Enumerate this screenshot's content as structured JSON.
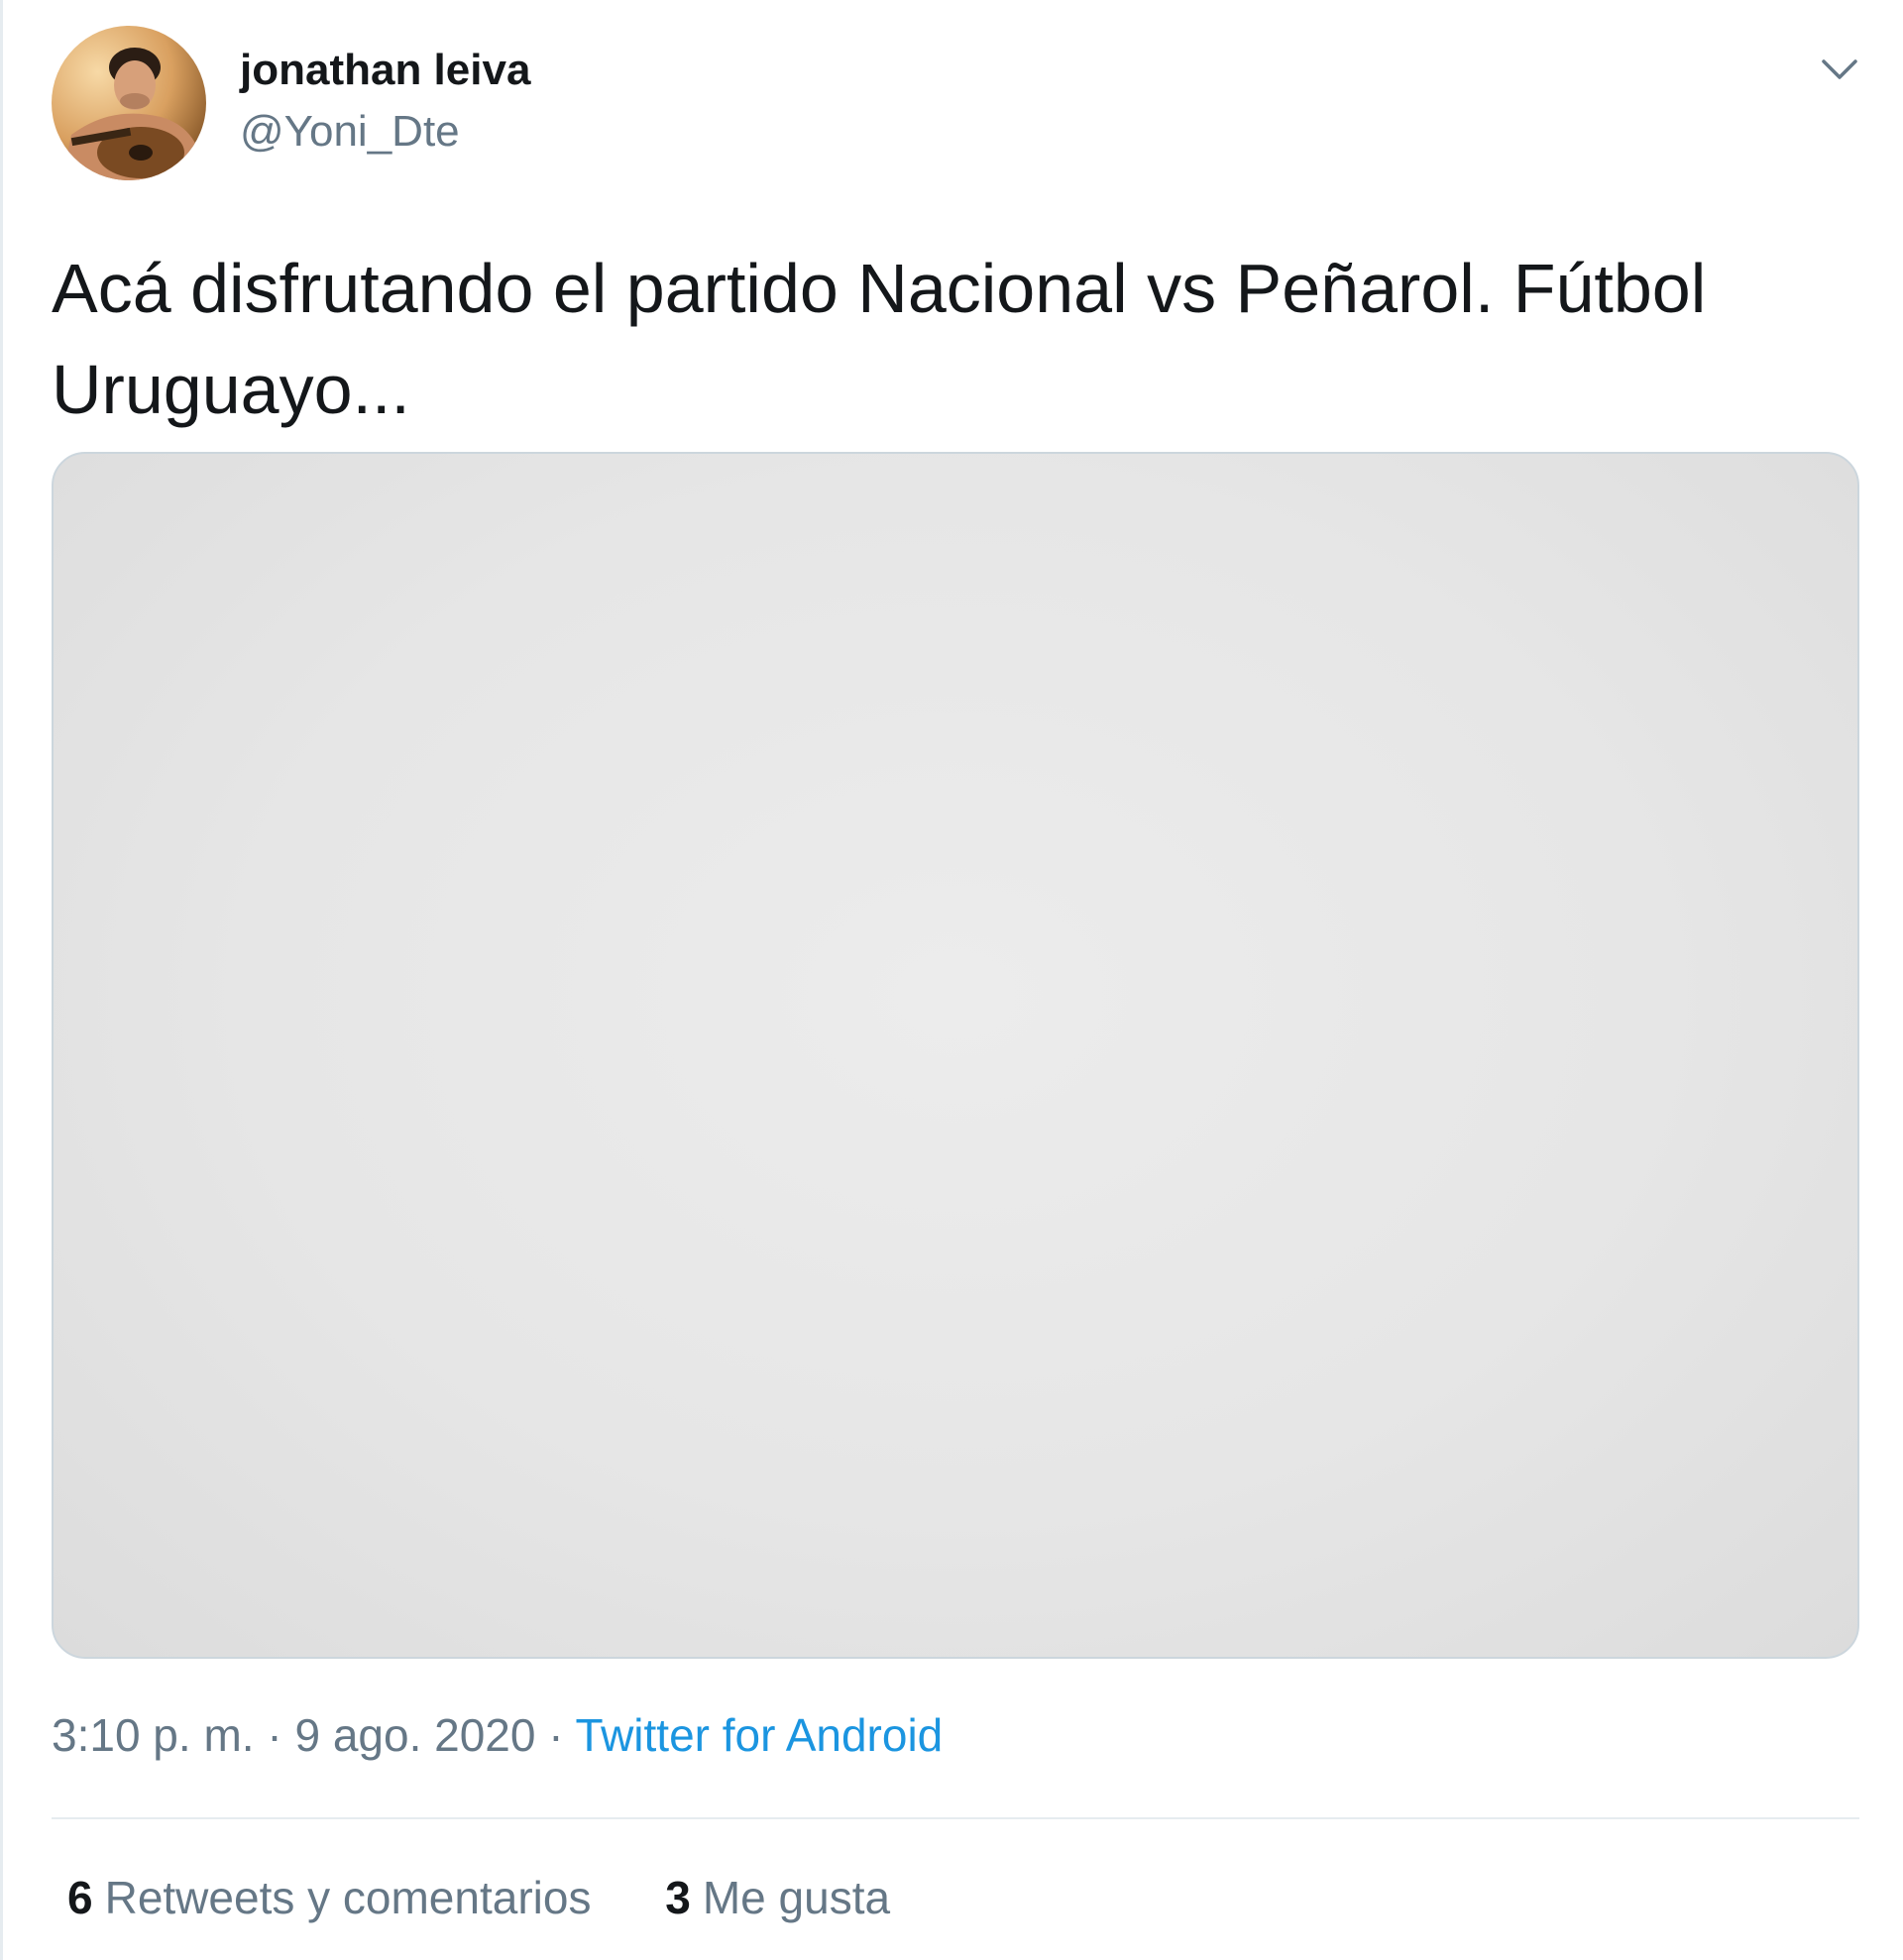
{
  "author": {
    "display_name": "jonathan leiva",
    "handle": "@Yoni_Dte",
    "avatar_icon": "profile-photo"
  },
  "header": {
    "caret_icon": "chevron-down-icon"
  },
  "tweet": {
    "text_line1": "Acá disfrutando el partido Nacional vs Peñarol. Fútbol",
    "text_line2": "Uruguayo..."
  },
  "media": {
    "description": "blank light gray image"
  },
  "meta": {
    "time": "3:10 p. m.",
    "separator1": " · ",
    "date": "9 ago. 2020",
    "separator2": " · ",
    "source": "Twitter for Android"
  },
  "stats": {
    "retweets_count": "6",
    "retweets_label": "Retweets y comentarios",
    "likes_count": "3",
    "likes_label": "Me gusta"
  },
  "colors": {
    "text_primary": "#14171a",
    "text_secondary": "#657786",
    "link": "#1b95e0",
    "border": "#e6ecf0"
  }
}
